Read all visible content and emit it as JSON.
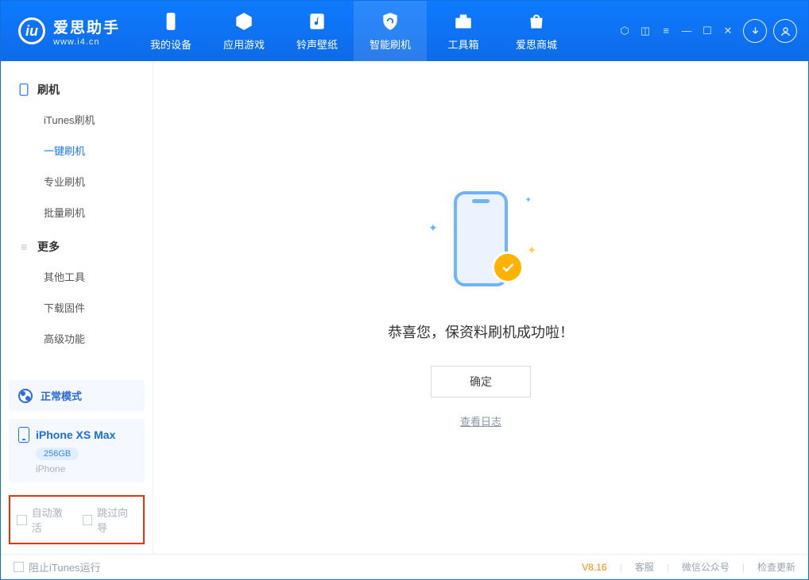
{
  "app": {
    "name": "爱思助手",
    "url": "www.i4.cn"
  },
  "nav": {
    "items": [
      {
        "label": "我的设备"
      },
      {
        "label": "应用游戏"
      },
      {
        "label": "铃声壁纸"
      },
      {
        "label": "智能刷机"
      },
      {
        "label": "工具箱"
      },
      {
        "label": "爱思商城"
      }
    ]
  },
  "sidebar": {
    "group1": {
      "title": "刷机",
      "items": [
        "iTunes刷机",
        "一键刷机",
        "专业刷机",
        "批量刷机"
      ],
      "active_index": 1
    },
    "group2": {
      "title": "更多",
      "items": [
        "其他工具",
        "下载固件",
        "高级功能"
      ]
    },
    "mode_card": "正常模式",
    "device": {
      "name": "iPhone XS Max",
      "capacity": "256GB",
      "subtitle": "iPhone"
    },
    "options": {
      "auto_activate": "自动激活",
      "skip_guide": "跳过向导"
    }
  },
  "main": {
    "success_text": "恭喜您，保资料刷机成功啦！",
    "ok_button": "确定",
    "view_log": "查看日志"
  },
  "footer": {
    "block_itunes": "阻止iTunes运行",
    "version": "V8.16",
    "links": [
      "客服",
      "微信公众号",
      "检查更新"
    ]
  }
}
